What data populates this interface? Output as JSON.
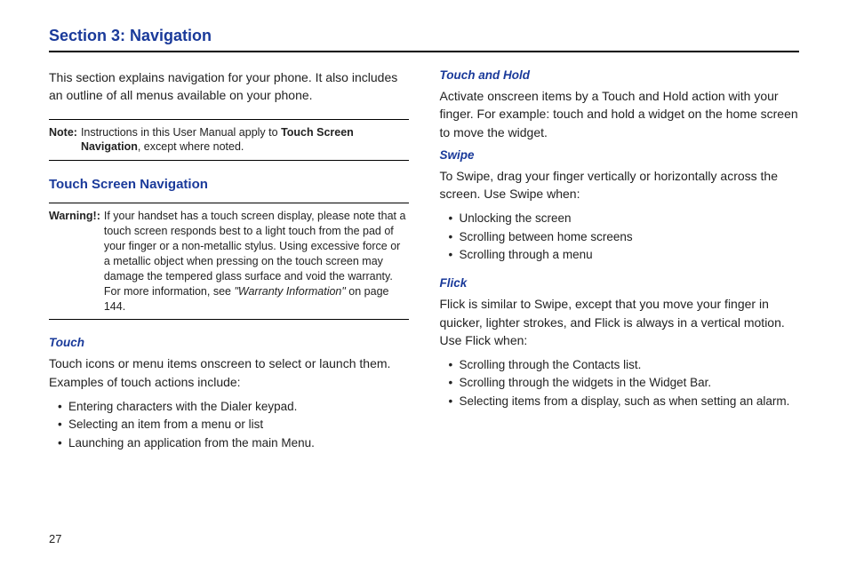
{
  "section_title": "Section 3: Navigation",
  "left": {
    "intro": "This section explains navigation for your phone. It also includes an outline of all menus available on your phone.",
    "note": {
      "label": "Note:",
      "text_pre": "Instructions in this User Manual apply to ",
      "text_bold": "Touch Screen Navigation",
      "text_post": ", except where noted."
    },
    "subsection": "Touch Screen Navigation",
    "warning": {
      "label": "Warning!:",
      "text_pre": "If your handset has a touch screen display, please note that a touch screen responds best to a light touch from the pad of your finger or a non-metallic stylus. Using excessive force or a metallic object when pressing on the touch screen may damage the tempered glass surface and void the warranty. For more information, see ",
      "italic": "\"Warranty Information\"",
      "text_post": " on page 144."
    },
    "touch": {
      "title": "Touch",
      "body": "Touch icons or menu items onscreen to select or launch them. Examples of touch actions include:",
      "bullets": [
        "Entering characters with the Dialer keypad.",
        "Selecting an item from a menu or list",
        "Launching an application from the main Menu."
      ]
    }
  },
  "right": {
    "touch_hold": {
      "title": "Touch and Hold",
      "body": "Activate onscreen items by a Touch and Hold action with your finger.  For example: touch and hold a widget on the home screen to move the widget."
    },
    "swipe": {
      "title": "Swipe",
      "body": "To Swipe, drag your finger vertically or horizontally across the screen.  Use Swipe when:",
      "bullets": [
        "Unlocking the screen",
        "Scrolling between home screens",
        "Scrolling through a menu"
      ]
    },
    "flick": {
      "title": "Flick",
      "body": "Flick is similar to Swipe, except that you move your finger in quicker, lighter strokes, and Flick is always in a vertical motion. Use Flick when:",
      "bullets": [
        "Scrolling through the Contacts list.",
        "Scrolling through the widgets in the Widget Bar.",
        "Selecting items from a display, such as when setting an alarm."
      ]
    }
  },
  "page_number": "27"
}
